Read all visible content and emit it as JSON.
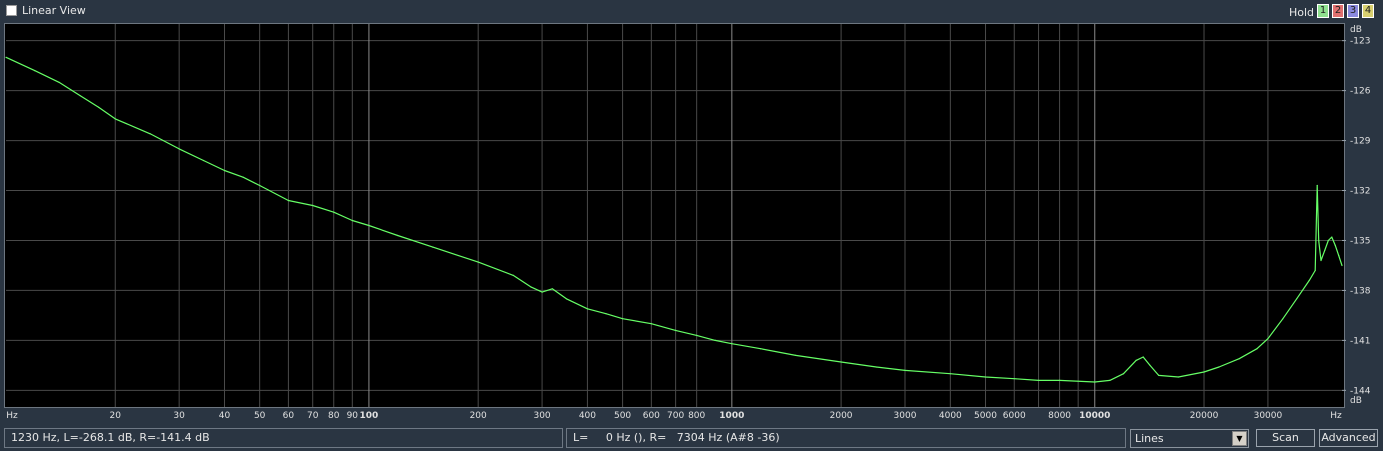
{
  "toolbar": {
    "linear_view_label": "Linear View",
    "linear_view_checked": false,
    "hold_label": "Hold",
    "hold_buttons": [
      {
        "label": "1",
        "color": "#8fe08f"
      },
      {
        "label": "2",
        "color": "#e07070"
      },
      {
        "label": "3",
        "color": "#8a8adf"
      },
      {
        "label": "4",
        "color": "#d8d070"
      }
    ]
  },
  "chart_data": {
    "type": "line",
    "x_scale": "log",
    "xlim": [
      10,
      48000
    ],
    "ylim": [
      -145,
      -122
    ],
    "x_unit": "Hz",
    "y_unit": "dB",
    "x_ticks": [
      {
        "v": 20,
        "label": "20"
      },
      {
        "v": 30,
        "label": "30"
      },
      {
        "v": 40,
        "label": "40"
      },
      {
        "v": 50,
        "label": "50"
      },
      {
        "v": 60,
        "label": "60"
      },
      {
        "v": 70,
        "label": "70"
      },
      {
        "v": 80,
        "label": "80"
      },
      {
        "v": 90,
        "label": "90"
      },
      {
        "v": 100,
        "label": "100",
        "major": true
      },
      {
        "v": 200,
        "label": "200"
      },
      {
        "v": 300,
        "label": "300"
      },
      {
        "v": 400,
        "label": "400"
      },
      {
        "v": 500,
        "label": "500"
      },
      {
        "v": 600,
        "label": "600"
      },
      {
        "v": 700,
        "label": "700"
      },
      {
        "v": 800,
        "label": "800"
      },
      {
        "v": 1000,
        "label": "1000",
        "major": true
      },
      {
        "v": 2000,
        "label": "2000"
      },
      {
        "v": 3000,
        "label": "3000"
      },
      {
        "v": 4000,
        "label": "4000"
      },
      {
        "v": 5000,
        "label": "5000"
      },
      {
        "v": 6000,
        "label": "6000"
      },
      {
        "v": 8000,
        "label": "8000"
      },
      {
        "v": 10000,
        "label": "10000",
        "major": true
      },
      {
        "v": 20000,
        "label": "20000"
      },
      {
        "v": 30000,
        "label": "30000"
      }
    ],
    "x_minor": [
      7000,
      9000
    ],
    "y_ticks": [
      -123,
      -126,
      -129,
      -132,
      -135,
      -138,
      -141,
      -144
    ],
    "series": [
      {
        "color": "#66ff66",
        "points": [
          [
            10,
            -124.0
          ],
          [
            12,
            -124.8
          ],
          [
            14,
            -125.5
          ],
          [
            16,
            -126.3
          ],
          [
            18,
            -127.0
          ],
          [
            20,
            -127.7
          ],
          [
            25,
            -128.6
          ],
          [
            30,
            -129.5
          ],
          [
            35,
            -130.2
          ],
          [
            40,
            -130.8
          ],
          [
            45,
            -131.2
          ],
          [
            50,
            -131.7
          ],
          [
            60,
            -132.6
          ],
          [
            70,
            -132.9
          ],
          [
            80,
            -133.3
          ],
          [
            90,
            -133.8
          ],
          [
            100,
            -134.1
          ],
          [
            120,
            -134.7
          ],
          [
            150,
            -135.4
          ],
          [
            200,
            -136.3
          ],
          [
            250,
            -137.1
          ],
          [
            280,
            -137.8
          ],
          [
            300,
            -138.1
          ],
          [
            320,
            -137.9
          ],
          [
            350,
            -138.5
          ],
          [
            400,
            -139.1
          ],
          [
            450,
            -139.4
          ],
          [
            500,
            -139.7
          ],
          [
            600,
            -140.0
          ],
          [
            700,
            -140.4
          ],
          [
            800,
            -140.7
          ],
          [
            900,
            -141.0
          ],
          [
            1000,
            -141.2
          ],
          [
            1200,
            -141.5
          ],
          [
            1500,
            -141.9
          ],
          [
            2000,
            -142.3
          ],
          [
            2500,
            -142.6
          ],
          [
            3000,
            -142.8
          ],
          [
            4000,
            -143.0
          ],
          [
            5000,
            -143.2
          ],
          [
            6000,
            -143.3
          ],
          [
            7000,
            -143.4
          ],
          [
            8000,
            -143.4
          ],
          [
            10000,
            -143.5
          ],
          [
            11000,
            -143.4
          ],
          [
            12000,
            -143.0
          ],
          [
            13000,
            -142.2
          ],
          [
            13600,
            -142.0
          ],
          [
            14200,
            -142.5
          ],
          [
            15000,
            -143.1
          ],
          [
            17000,
            -143.2
          ],
          [
            20000,
            -142.9
          ],
          [
            22000,
            -142.6
          ],
          [
            25000,
            -142.1
          ],
          [
            28000,
            -141.5
          ],
          [
            30000,
            -140.9
          ],
          [
            33000,
            -139.7
          ],
          [
            36000,
            -138.5
          ],
          [
            39000,
            -137.4
          ],
          [
            40500,
            -136.8
          ],
          [
            41000,
            -131.7
          ],
          [
            41400,
            -135.0
          ],
          [
            42000,
            -136.2
          ],
          [
            43000,
            -135.6
          ],
          [
            44000,
            -135.0
          ],
          [
            45000,
            -134.8
          ],
          [
            46000,
            -135.3
          ],
          [
            47000,
            -135.9
          ],
          [
            48000,
            -136.5
          ]
        ]
      }
    ]
  },
  "status": {
    "left": "1230 Hz, L=-268.1 dB, R=-141.4 dB",
    "right": "L=     0 Hz (), R=   7304 Hz (A#8 -36)"
  },
  "controls": {
    "mode_value": "Lines",
    "scan_label": "Scan",
    "advanced_label": "Advanced"
  }
}
